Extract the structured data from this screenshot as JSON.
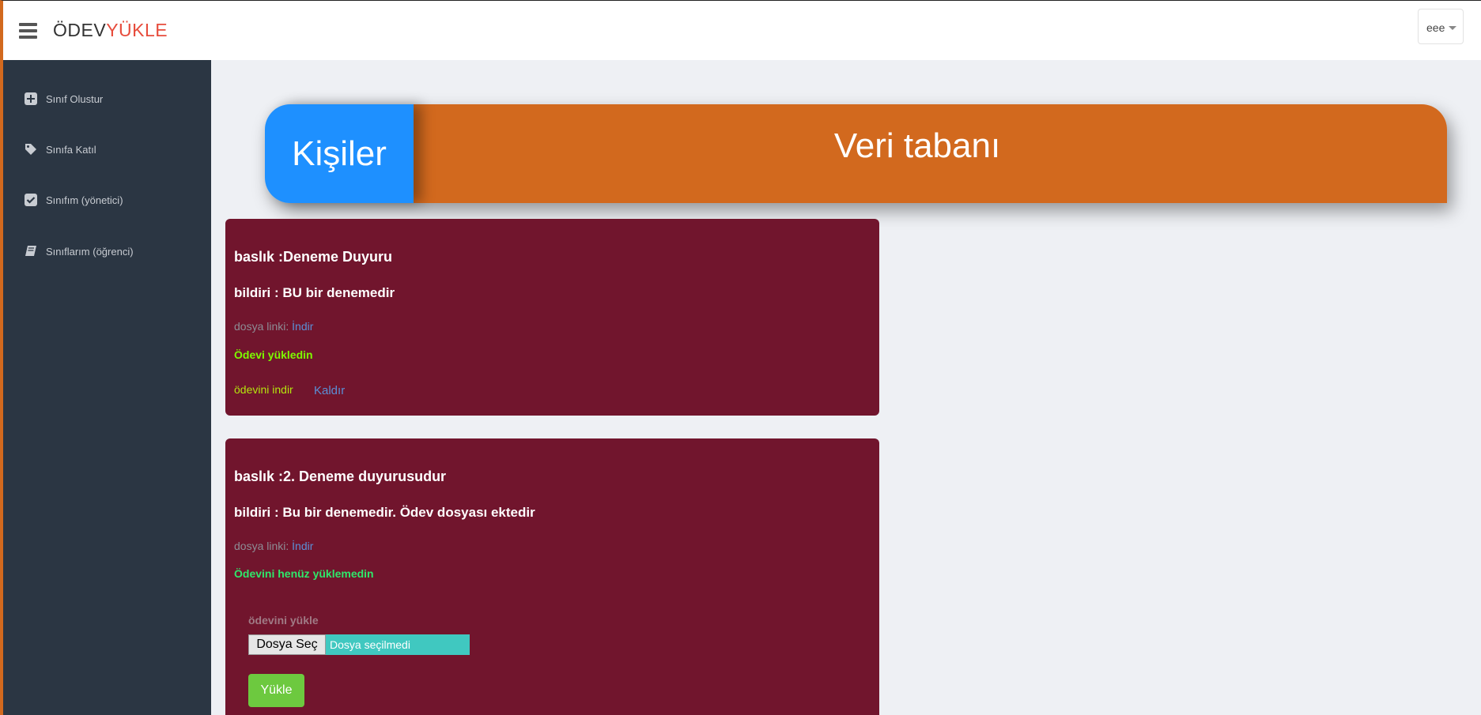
{
  "app": {
    "logo_part1": "ÖDEV",
    "logo_part2": "YÜKLE",
    "user": "eee"
  },
  "sidebar": {
    "items": [
      {
        "label": "Sınıf Olustur",
        "icon": "plus-square-icon"
      },
      {
        "label": "Sınıfa Katıl",
        "icon": "tag-icon"
      },
      {
        "label": "Sınıfım (yönetici)",
        "icon": "check-square-icon"
      },
      {
        "label": "Sınıflarım (öğrenci)",
        "icon": "book-icon"
      }
    ]
  },
  "banner": {
    "left": "Kişiler",
    "right": "Veri tabanı"
  },
  "cards": [
    {
      "title": "baslık :Deneme Duyuru",
      "body": "bildiri : BU bir denemedir",
      "file_label": "dosya linki:",
      "file_link": "İndir",
      "status": "Ödevi yükledin",
      "download": "ödevini indir",
      "remove": "Kaldır"
    },
    {
      "title": "baslık :2. Deneme duyurusudur",
      "body": "bildiri : Bu bir denemedir. Ödev dosyası ektedir",
      "file_label": "dosya linki:",
      "file_link": "İndir",
      "status": "Ödevini henüz yüklemedin",
      "upload_label": "ödevini yükle",
      "choose_file": "Dosya Seç",
      "no_file": "Dosya seçilmedi",
      "submit": "Yükle"
    }
  ],
  "colors": {
    "accent": "#d2691e",
    "blue": "#1e90ff",
    "card": "#71152d",
    "sidebar": "#2b3643"
  }
}
